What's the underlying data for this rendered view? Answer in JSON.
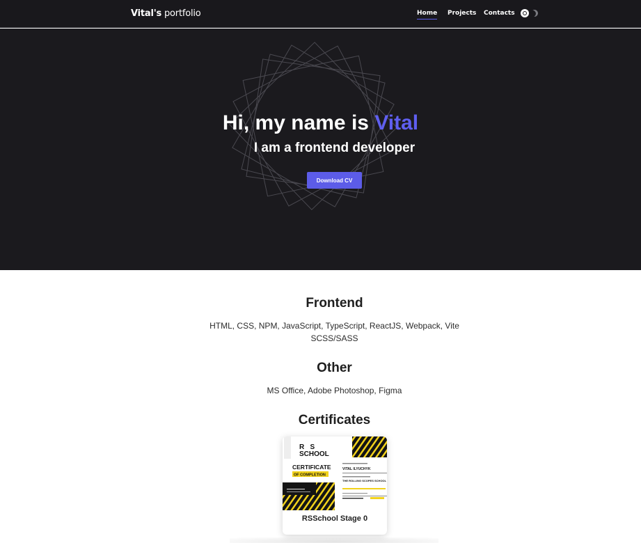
{
  "header": {
    "logo_bold": "Vital's",
    "logo_rest": " portfolio",
    "nav": [
      {
        "label": "Home",
        "active": true
      },
      {
        "label": "Projects",
        "active": false
      },
      {
        "label": "Contacts",
        "active": false
      }
    ],
    "theme_icons": [
      "sun-icon",
      "moon-icon"
    ]
  },
  "hero": {
    "title_prefix": "Hi, my name is ",
    "title_accent": "Vital",
    "subtitle": "I am a frontend developer",
    "button_label": "Download CV"
  },
  "skills": {
    "frontend_title": "Frontend",
    "frontend_text": "HTML, CSS, NPM, JavaScript, TypeScript, ReactJS, Webpack, Vite SCSS/SASS",
    "other_title": "Other",
    "other_text": "MS Office, Adobe Photoshop, Figma"
  },
  "certificates": {
    "title": "Certificates",
    "items": [
      {
        "caption": "RSSchool Stage 0",
        "image": {
          "logo_line1": "R   S",
          "logo_line2": "SCHOOL",
          "heading": "CERTIFICATE",
          "highlight": "OF COMPLETION",
          "name": "VITAL ILYUCHYK",
          "school": "THE ROLLING SCOPES SCHOOL"
        }
      }
    ]
  },
  "colors": {
    "accent": "#5f5ff0",
    "header_bg": "#19181c",
    "hero_bg": "#1b1a1e",
    "cert_yellow": "#f2d21b"
  }
}
